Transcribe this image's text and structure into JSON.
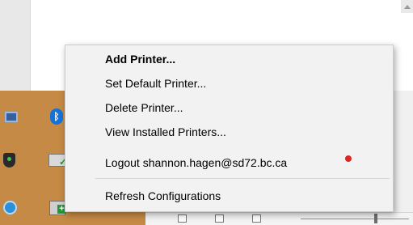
{
  "context_menu": {
    "items": [
      {
        "label": "Add Printer..."
      },
      {
        "label": "Set Default Printer..."
      },
      {
        "label": "Delete Printer..."
      },
      {
        "label": "View Installed Printers..."
      },
      {
        "label": "Logout shannon.hagen@sd72.bc.ca"
      },
      {
        "label": "Refresh Configurations"
      }
    ]
  },
  "icons": {
    "tray": [
      "monitor-icon",
      "bluetooth-icon",
      "shield-icon",
      "printer-check-icon",
      "globe-icon",
      "printer-add-icon"
    ],
    "bottom_bar": [
      "page-icon",
      "page-icon",
      "page-icon"
    ]
  },
  "colors": {
    "menu_background": "#f2f2f2",
    "tray_background": "#c58a45",
    "marker": "#e02424"
  }
}
